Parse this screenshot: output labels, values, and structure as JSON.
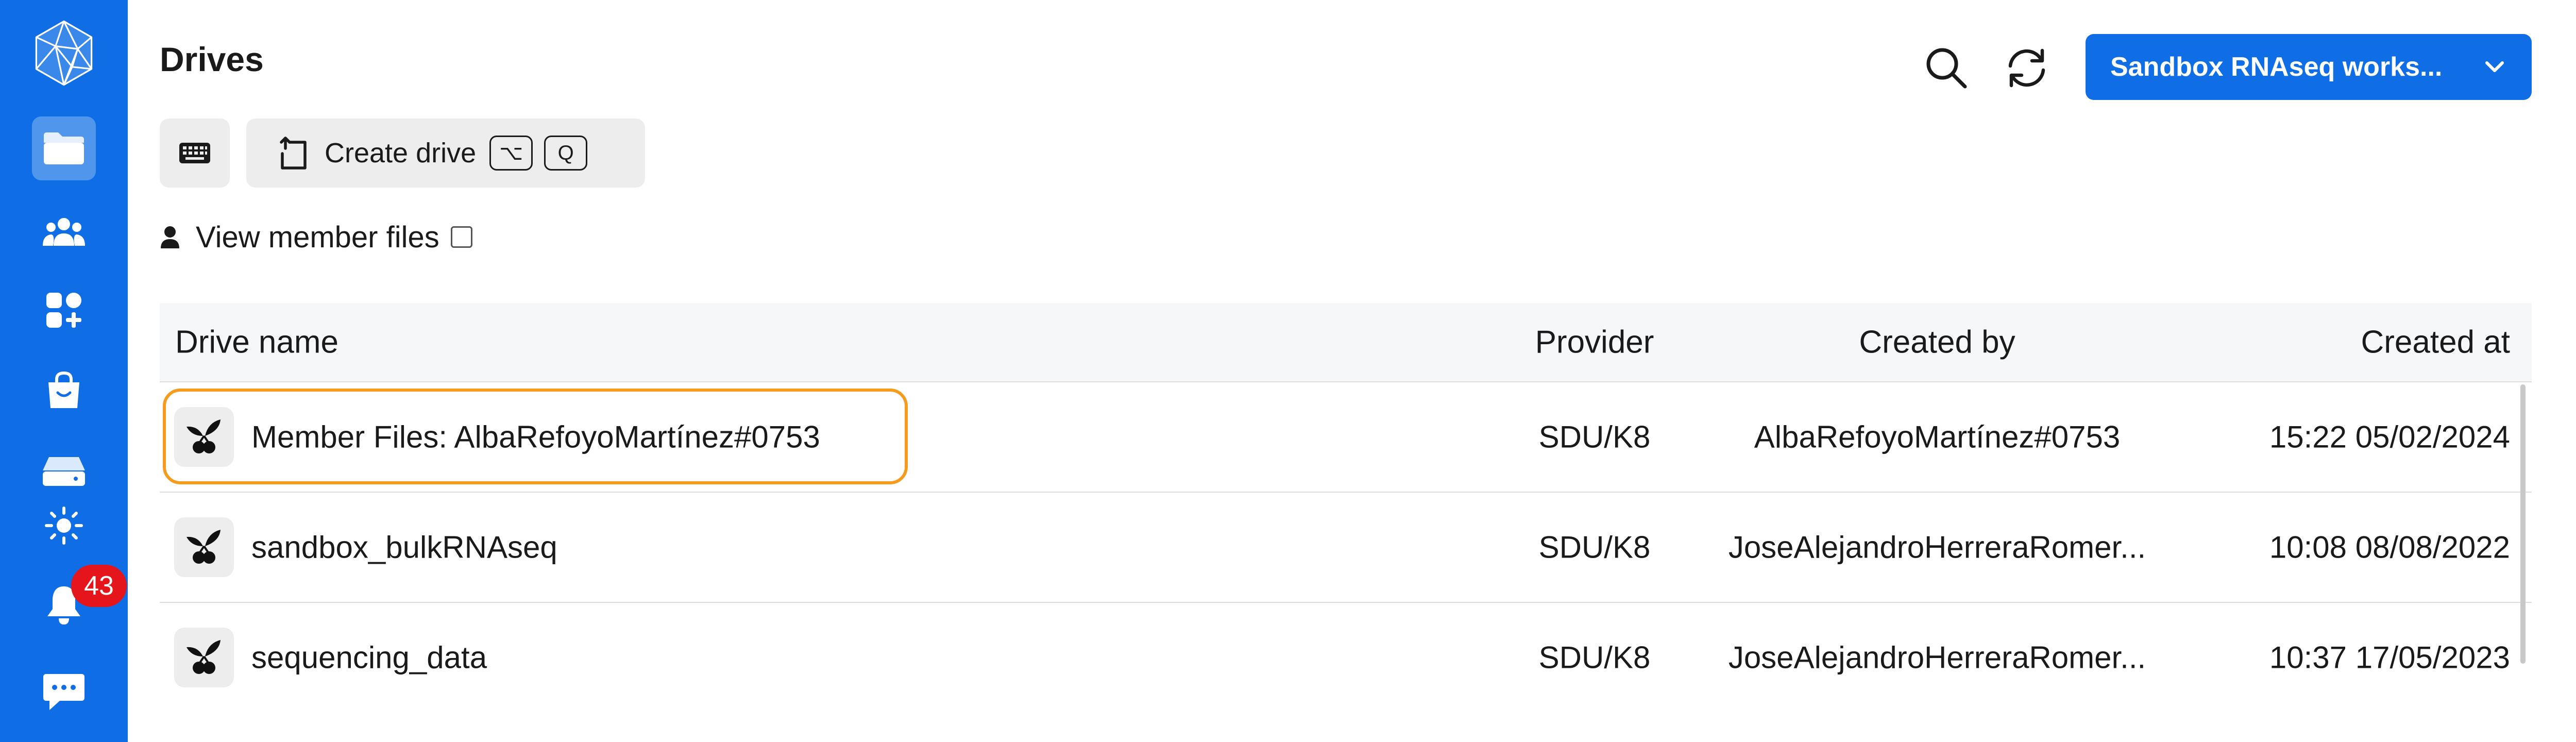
{
  "sidebar": {
    "notification_count": "43",
    "items": [
      {
        "icon": "folder-icon",
        "active": true
      },
      {
        "icon": "users-icon"
      },
      {
        "icon": "apps-icon"
      },
      {
        "icon": "shopping-bag-icon"
      },
      {
        "icon": "hard-drive-icon"
      },
      {
        "icon": "sun-icon"
      },
      {
        "icon": "bell-icon"
      },
      {
        "icon": "chat-icon"
      }
    ]
  },
  "header": {
    "title": "Drives",
    "project_label": "Sandbox RNAseq works..."
  },
  "toolbar": {
    "create_label": "Create drive",
    "shortcut_keys": [
      "⌥",
      "Q"
    ]
  },
  "member_files": {
    "label": "View member files",
    "checked": false
  },
  "table": {
    "columns": [
      "Drive name",
      "Provider",
      "Created by",
      "Created at"
    ],
    "rows": [
      {
        "name": "Member Files: AlbaRefoyoMartínez#0753",
        "provider": "SDU/K8",
        "created_by": "AlbaRefoyoMartínez#0753",
        "created_at": "15:22 05/02/2024",
        "selected": true
      },
      {
        "name": "sandbox_bulkRNAseq",
        "provider": "SDU/K8",
        "created_by": "JoseAlejandroHerreraRomer...",
        "created_at": "10:08 08/08/2022"
      },
      {
        "name": "sequencing_data",
        "provider": "SDU/K8",
        "created_by": "JoseAlejandroHerreraRomer...",
        "created_at": "10:37 17/05/2023"
      }
    ]
  },
  "colors": {
    "sidebar": "#0f6ee6",
    "accent": "#0f6ee6",
    "badge": "#e5161b",
    "selection_outline": "#f59b1e"
  }
}
